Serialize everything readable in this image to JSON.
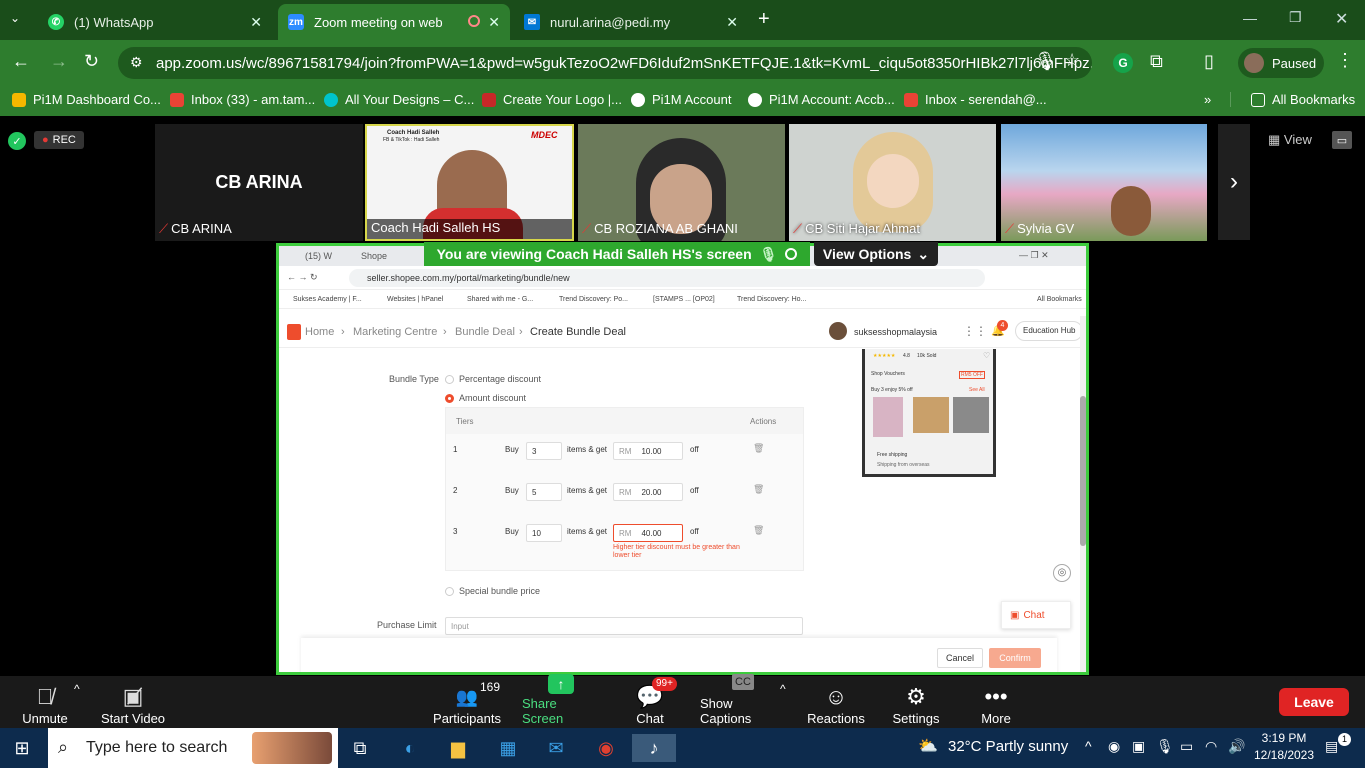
{
  "browser": {
    "tabs": [
      {
        "label": "(1) WhatsApp",
        "icon": "whatsapp-icon"
      },
      {
        "label": "Zoom meeting on web",
        "icon": "zoom-icon"
      },
      {
        "label": "nurul.arina@pedi.my",
        "icon": "mail-icon"
      }
    ],
    "url": "app.zoom.us/wc/89671581794/join?fromPWA=1&pwd=w5gukTezoO2wFD6Iduf2mSnKETFQJE.1&tk=KvmL_ciqu5ot8350rHIBk27l7lj6mFHpz...",
    "profile_label": "Paused",
    "bookmarks": [
      "Pi1M Dashboard Co...",
      "Inbox (33) - am.tam...",
      "All Your Designs – C...",
      "Create Your Logo |...",
      "Pi1M Account",
      "Pi1M Account: Accb...",
      "Inbox - serendah@..."
    ],
    "all_bookmarks": "All Bookmarks"
  },
  "zoom": {
    "rec_label": "REC",
    "view_label": "View",
    "participants_tiles": [
      {
        "name": "CB ARINA",
        "big_name": "CB ARINA"
      },
      {
        "name": "Coach Hadi Salleh HS",
        "slide_line1": "Coach Hadi Salleh",
        "slide_line2": "FB & TikTok : Hadi Salleh",
        "brand": "MDEC"
      },
      {
        "name": "CB ROZIANA AB GHANI"
      },
      {
        "name": "CB Siti Hajar Ahmat"
      },
      {
        "name": "Sylvia GV"
      }
    ],
    "banner": "You are viewing  Coach Hadi Salleh HS's screen",
    "view_options": "View Options",
    "toolbar": {
      "unmute": "Unmute",
      "start_video": "Start Video",
      "participants_count": "169",
      "participants": "Participants",
      "share_screen": "Share Screen",
      "chat_badge": "99+",
      "chat": "Chat",
      "captions_icon": "CC",
      "show_captions": "Show Captions",
      "reactions": "Reactions",
      "settings": "Settings",
      "more": "More",
      "leave": "Leave"
    }
  },
  "shared": {
    "inner_url": "seller.shopee.com.my/portal/marketing/bundle/new",
    "inner_tabs": [
      "(15) W",
      "Shope"
    ],
    "inner_bookmarks": [
      "Sukses Academy | F...",
      "Websites | hPanel",
      "Shared with me - G...",
      "Trend Discovery: Po...",
      "[STAMPS ... [OP02]",
      "Trend Discovery: Ho..."
    ],
    "inner_all_bookmarks": "All Bookmarks",
    "breadcrumb": [
      "Home",
      "Marketing Centre",
      "Bundle Deal",
      "Create Bundle Deal"
    ],
    "shop_name": "suksesshopmalaysia",
    "education_hub": "Education Hub",
    "notif_count": "4",
    "bundle_type_label": "Bundle Type",
    "options": {
      "percentage": "Percentage discount",
      "amount": "Amount discount",
      "special": "Special bundle price"
    },
    "tiers_header": "Tiers",
    "actions_header": "Actions",
    "buy": "Buy",
    "items_get": "items & get",
    "rm": "RM",
    "off": "off",
    "tiers": [
      {
        "num": "1",
        "qty": "3",
        "amount": "10.00"
      },
      {
        "num": "2",
        "qty": "5",
        "amount": "20.00"
      },
      {
        "num": "3",
        "qty": "10",
        "amount": "40.00"
      }
    ],
    "error_text": "Higher tier discount must be greater than lower tier",
    "purchase_limit": "Purchase Limit",
    "input_placeholder": "Input",
    "cancel": "Cancel",
    "confirm": "Confirm",
    "chat_label": "Chat",
    "preview": {
      "rating": "4.8",
      "sold": "10k Sold",
      "vouchers": "Shop Vouchers",
      "voucher_tag": "RM5 OFF",
      "buy_more": "Buy 3 enjoy 5% off",
      "see_all": "See All",
      "free_shipping": "Free shipping",
      "shipping_from": "Shipping from overseas"
    }
  },
  "taskbar": {
    "search_placeholder": "Type here to search",
    "weather": "32°C  Partly sunny",
    "time": "3:19 PM",
    "date": "12/18/2023",
    "notif_count": "1"
  }
}
